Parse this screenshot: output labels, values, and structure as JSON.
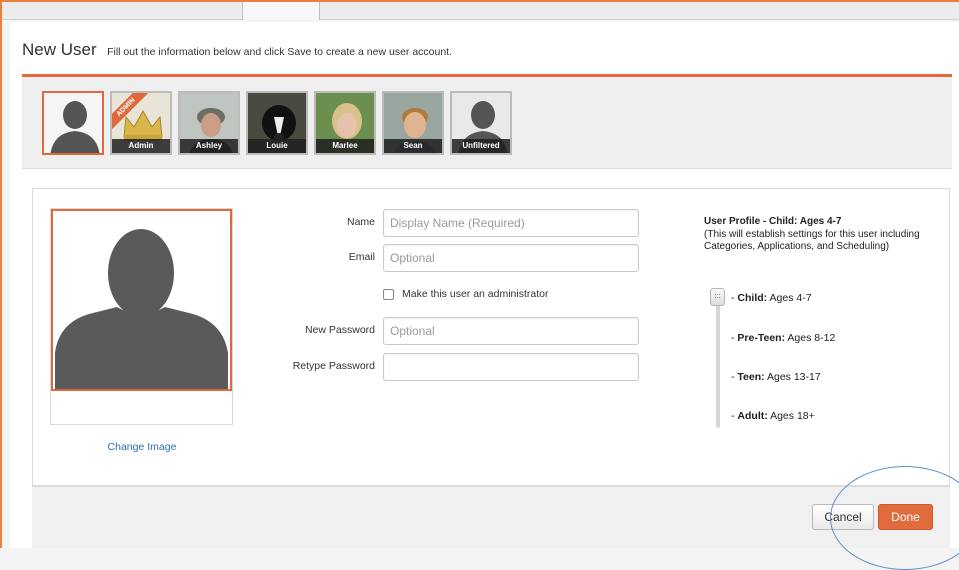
{
  "header": {
    "title": "New User",
    "subtitle": "Fill out the information below and click Save to create a new user account."
  },
  "users": [
    {
      "name": "",
      "selected": true,
      "badge": "",
      "icon": "silhouette-icon"
    },
    {
      "name": "Admin",
      "selected": false,
      "badge": "ADMIN",
      "icon": "crown-icon"
    },
    {
      "name": "Ashley",
      "selected": false,
      "badge": "",
      "icon": "photo-icon"
    },
    {
      "name": "Louie",
      "selected": false,
      "badge": "",
      "icon": "dog-photo-icon"
    },
    {
      "name": "Marlee",
      "selected": false,
      "badge": "",
      "icon": "photo-icon"
    },
    {
      "name": "Sean",
      "selected": false,
      "badge": "",
      "icon": "photo-icon"
    },
    {
      "name": "Unfiltered",
      "selected": false,
      "badge": "",
      "icon": "silhouette-icon"
    }
  ],
  "form": {
    "name_label": "Name",
    "name_placeholder": "Display Name (Required)",
    "email_label": "Email",
    "email_placeholder": "Optional",
    "admin_checkbox_label": "Make this user an administrator",
    "admin_checked": false,
    "new_password_label": "New Password",
    "new_password_placeholder": "Optional",
    "retype_password_label": "Retype Password",
    "retype_password_placeholder": ""
  },
  "photo": {
    "change_image_label": "Change Image"
  },
  "profile": {
    "title": "User Profile - Child: Ages 4-7",
    "description": "(This will establish settings for this user including Categories, Applications, and Scheduling)",
    "handle_glyph": ":::",
    "levels": [
      {
        "bold": "Child:",
        "rest": " Ages 4-7"
      },
      {
        "bold": "Pre-Teen:",
        "rest": " Ages 8-12"
      },
      {
        "bold": "Teen:",
        "rest": " Ages 13-17"
      },
      {
        "bold": "Adult:",
        "rest": " Ages 18+"
      }
    ],
    "selected_level": "Child:"
  },
  "footer": {
    "cancel_label": "Cancel",
    "done_label": "Done"
  },
  "colors": {
    "accent": "#e06b3d",
    "link": "#2f6fb0",
    "annotation": "#5b8fc7"
  }
}
